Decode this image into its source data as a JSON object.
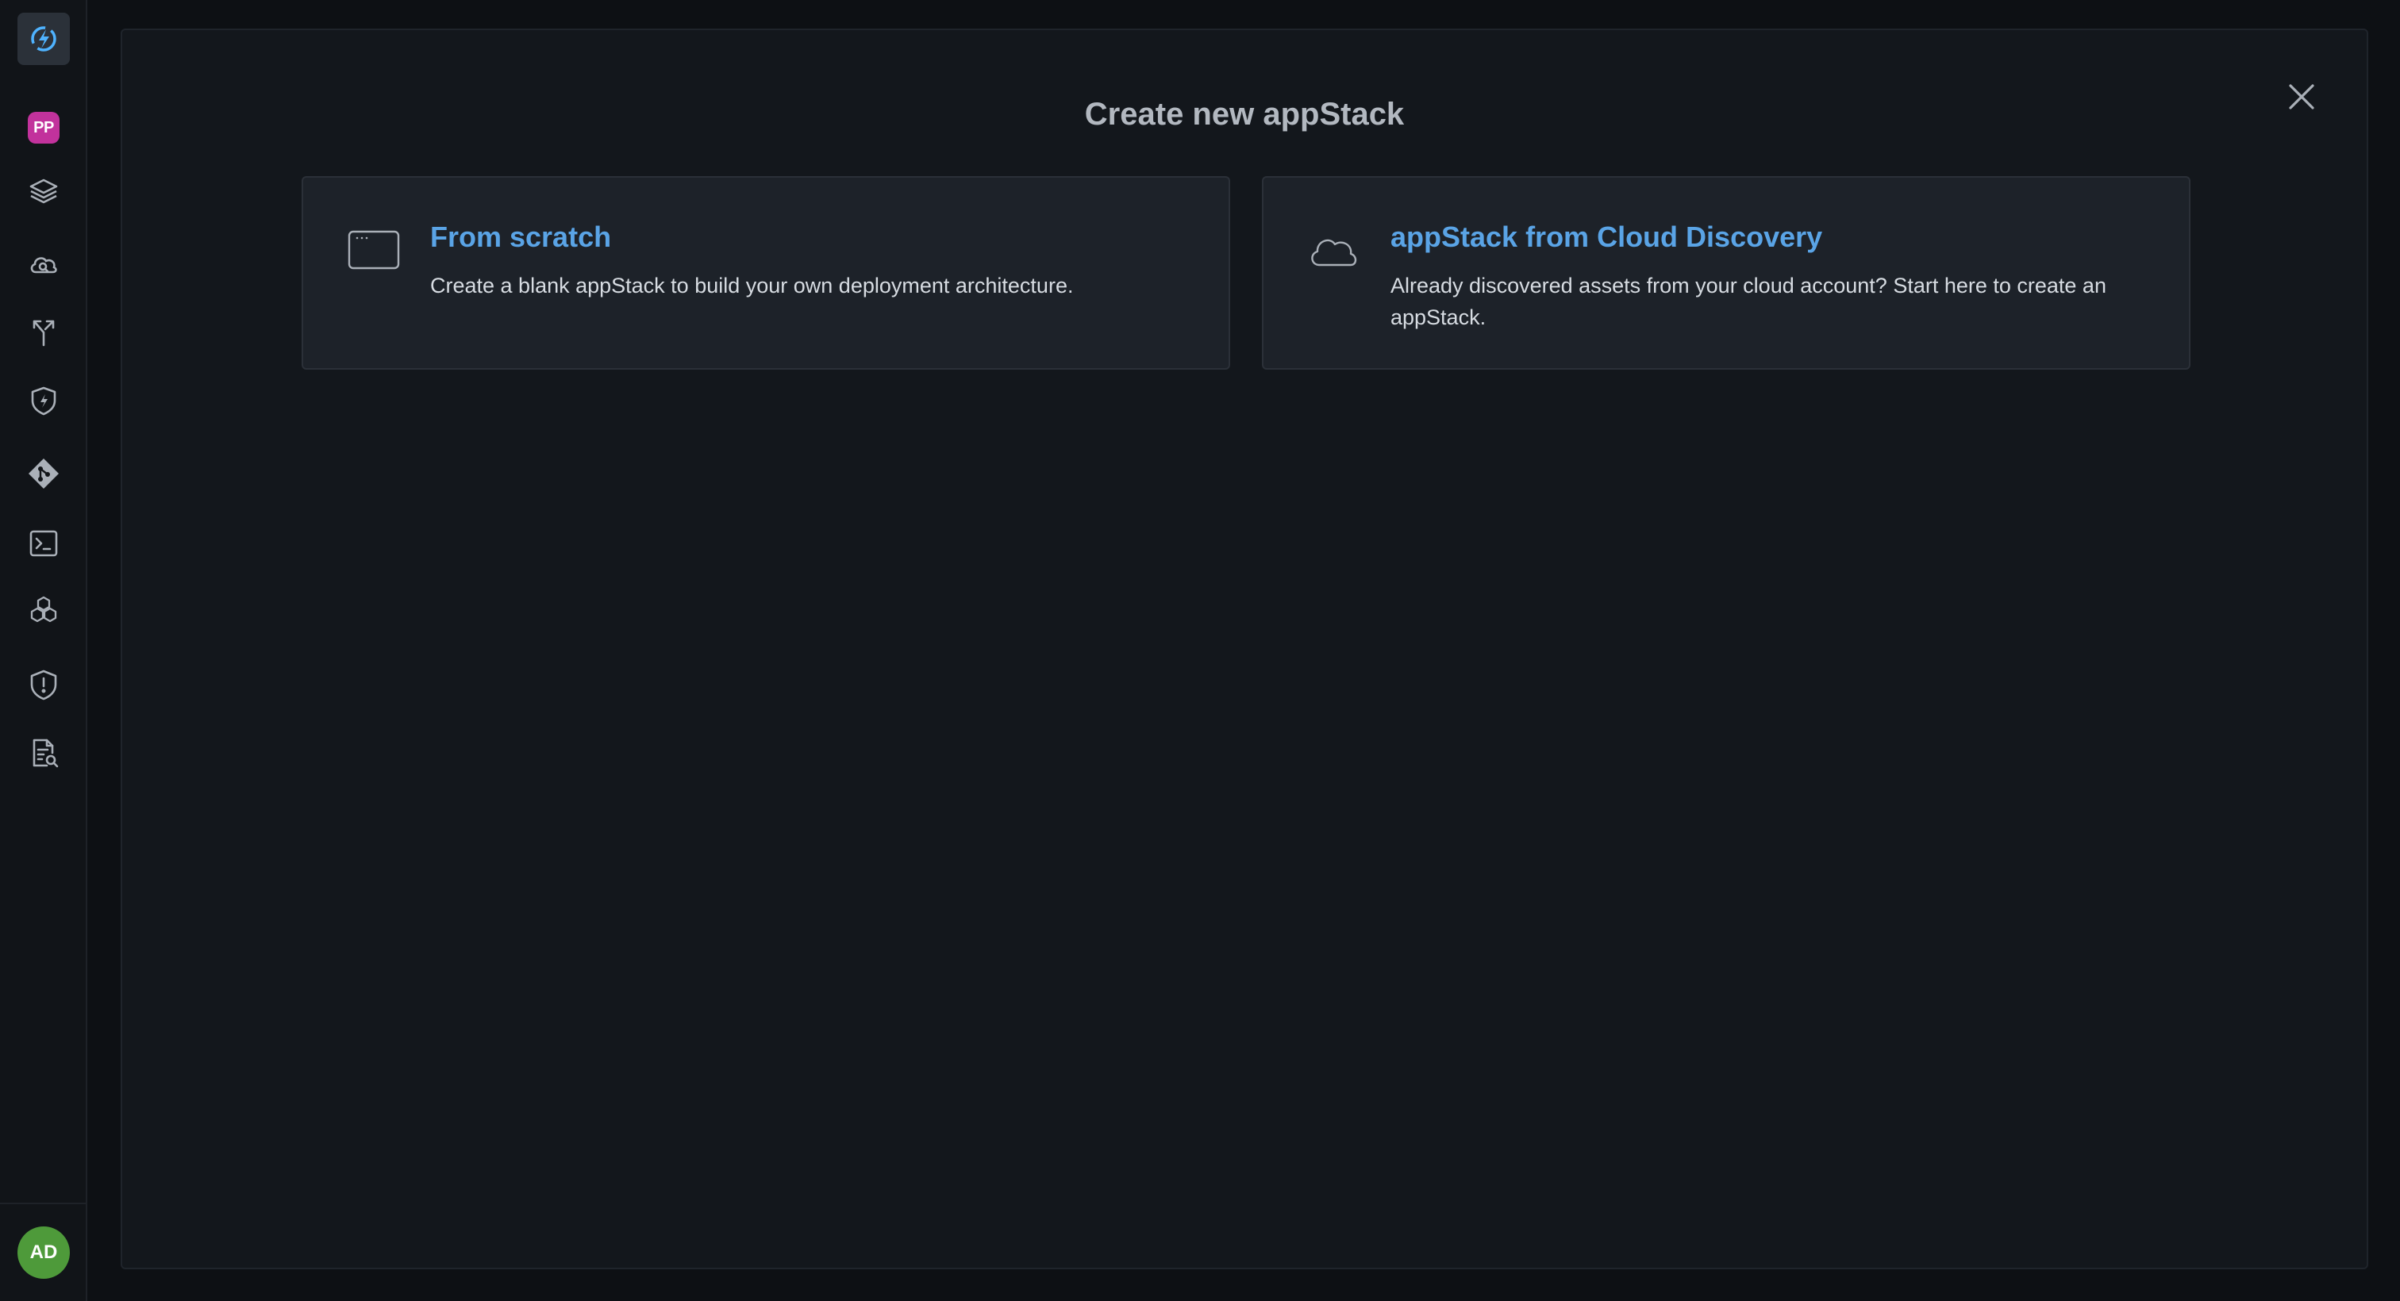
{
  "sidebar": {
    "workspace_badge": "PP",
    "user_initials": "AD",
    "items": [
      {
        "name": "layers-icon"
      },
      {
        "name": "cloud-search-icon"
      },
      {
        "name": "branch-arrow-icon"
      },
      {
        "name": "shield-bolt-icon"
      },
      {
        "name": "git-icon"
      },
      {
        "name": "terminal-icon"
      },
      {
        "name": "cubes-icon"
      },
      {
        "name": "shield-alert-icon"
      },
      {
        "name": "file-search-icon"
      }
    ]
  },
  "modal": {
    "title": "Create new appStack",
    "close_icon": "close-icon",
    "options": [
      {
        "icon": "window-icon",
        "title": "From scratch",
        "description": "Create a blank appStack to build your own deployment architecture."
      },
      {
        "icon": "cloud-icon",
        "title": "appStack from Cloud Discovery",
        "description": "Already discovered assets from your cloud account? Start here to create an appStack."
      }
    ]
  },
  "colors": {
    "background": "#0d1014",
    "modal": "#13171c",
    "card": "#1d2229",
    "accent": "#5aa4e6",
    "workspace_badge": "#c2329c",
    "avatar": "#4e9a3a"
  }
}
